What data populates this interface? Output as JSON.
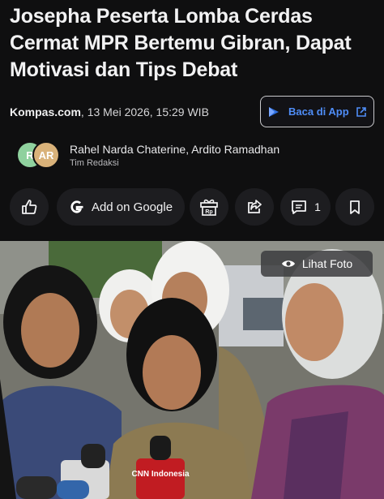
{
  "article": {
    "headline": "Josepha Peserta Lomba Cerdas Cermat MPR Bertemu Gibran, Dapat Motivasi dan Tips Debat",
    "source": "Kompas.com",
    "date": ", 13 Mei 2026, 15:29 WIB"
  },
  "app_button": {
    "label": "Baca di App",
    "icon": "external-link-icon"
  },
  "authors": {
    "avatar1": "R",
    "avatar2": "AR",
    "names": "Rahel Narda Chaterine,  Ardito Ramadhan",
    "team": "Tim Redaksi"
  },
  "actions": {
    "like_icon": "thumbs-up-icon",
    "google_label": "Add on Google",
    "gift_icon": "gift-rp-icon",
    "gift_badge": "Rp",
    "share_icon": "share-icon",
    "comment_count": "1",
    "bookmark_icon": "bookmark-icon"
  },
  "photo": {
    "view_label": "Lihat Foto",
    "mic_label": "CNN Indonesia"
  },
  "colors": {
    "background": "#0f0f10",
    "link_blue": "#4f8df7",
    "button_bg": "#1d1d20"
  }
}
